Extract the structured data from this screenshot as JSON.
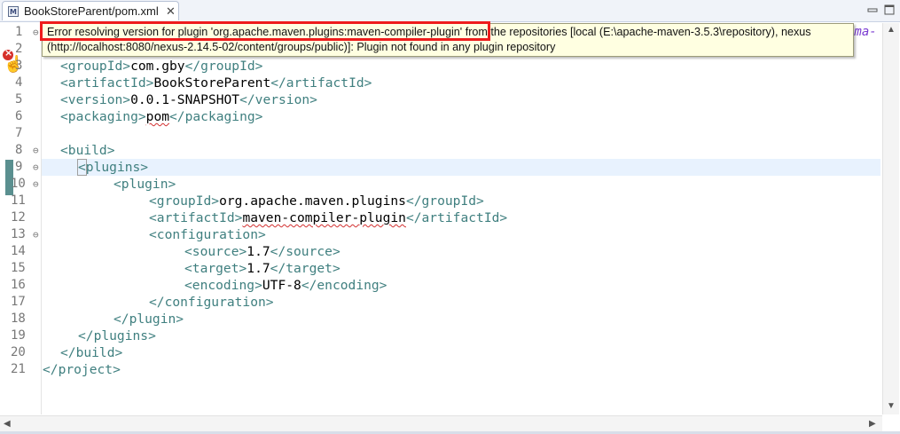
{
  "tab": {
    "label": "BookStoreParent/pom.xml",
    "close_glyph": "✕",
    "icon": "xml-file-icon"
  },
  "tooltip": {
    "line1_highlight": "Error resolving version for plugin 'org.apache.maven.plugins:maven-compiler-plugin'",
    "line1_rest": " from the repositories [local (E:\\apache-maven-3.5.3\\repository), nexus",
    "line2": "(http://localhost:8080/nexus-2.14.5-02/content/groups/public)]: Plugin not found in any plugin repository"
  },
  "partial_right_text": "ema-",
  "line_numbers": [
    "1",
    "2",
    "3",
    "4",
    "5",
    "6",
    "7",
    "8",
    "9",
    "10",
    "11",
    "12",
    "13",
    "14",
    "15",
    "16",
    "17",
    "18",
    "19",
    "20",
    "21"
  ],
  "code": {
    "l3": {
      "open": "<groupId>",
      "text": "com.gby",
      "close": "</groupId>"
    },
    "l4": {
      "open": "<artifactId>",
      "text": "BookStoreParent",
      "close": "</artifactId>"
    },
    "l5": {
      "open": "<version>",
      "text": "0.0.1-SNAPSHOT",
      "close": "</version>"
    },
    "l6": {
      "open": "<packaging>",
      "text": "pom",
      "close": "</packaging>"
    },
    "l8": "<build>",
    "l9_lt": "<",
    "l9_rest": "plugins>",
    "l10": "<plugin>",
    "l11": {
      "open": "<groupId>",
      "text": "org.apache.maven.plugins",
      "close": "</groupId>"
    },
    "l12": {
      "open": "<artifactId>",
      "text": "maven-compiler-plugin",
      "close": "</artifactId>"
    },
    "l13": "<configuration>",
    "l14": {
      "open": "<source>",
      "text": "1.7",
      "close": "</source>"
    },
    "l15": {
      "open": "<target>",
      "text": "1.7",
      "close": "</target>"
    },
    "l16": {
      "open": "<encoding>",
      "text": "UTF-8",
      "close": "</encoding>"
    },
    "l17": "</configuration>",
    "l18": "</plugin>",
    "l19": "</plugins>",
    "l20": "</build>",
    "l21": "</project>"
  },
  "colors": {
    "tag": "#3f7f7f",
    "text": "#000000",
    "highlight_box": "#ee1c1c",
    "tooltip_bg": "#ffffe1",
    "current_line": "#e8f2fe"
  }
}
